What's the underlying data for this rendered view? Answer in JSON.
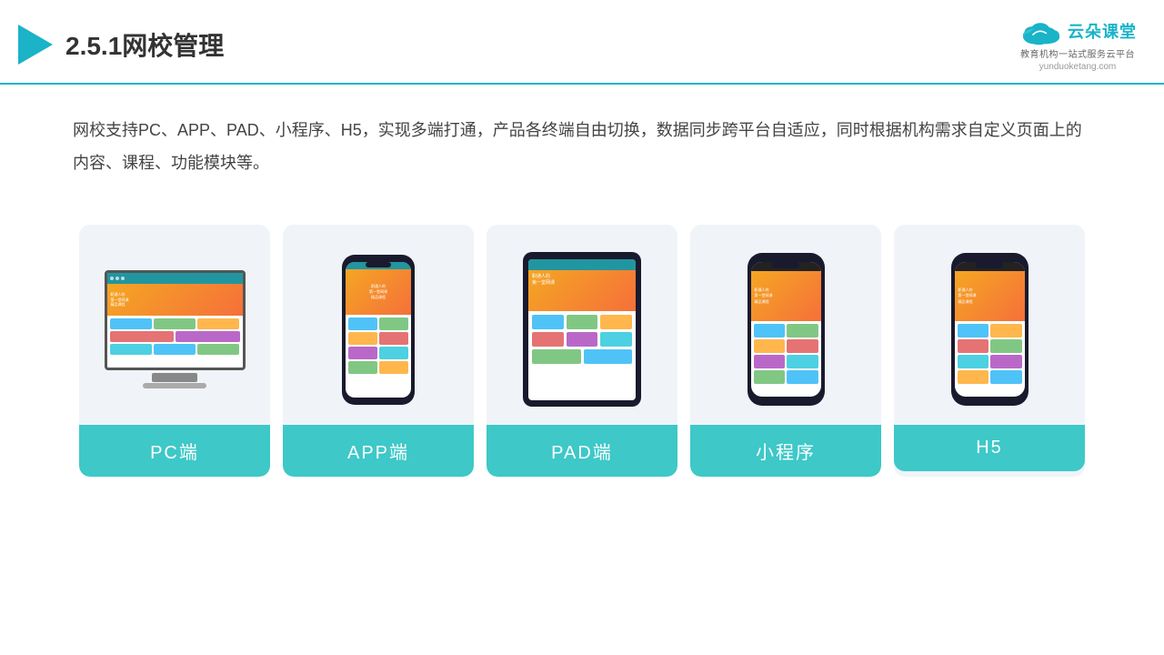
{
  "header": {
    "title": "2.5.1网校管理",
    "logo_text": "云朵课堂",
    "logo_sub": "教育机构一站式服务云平台",
    "logo_url": "yunduoketang.com"
  },
  "description": {
    "text": "网校支持PC、APP、PAD、小程序、H5，实现多端打通，产品各终端自由切换，数据同步跨平台自适应，同时根据机构需求自定义页面上的内容、课程、功能模块等。"
  },
  "cards": [
    {
      "id": "pc",
      "label": "PC端",
      "type": "monitor"
    },
    {
      "id": "app",
      "label": "APP端",
      "type": "phone"
    },
    {
      "id": "pad",
      "label": "PAD端",
      "type": "tablet"
    },
    {
      "id": "miniprogram",
      "label": "小程序",
      "type": "mini-phone"
    },
    {
      "id": "h5",
      "label": "H5",
      "type": "mini-phone"
    }
  ],
  "colors": {
    "accent": "#1ab3c8",
    "card_label_bg": "#3ec8c8",
    "card_bg": "#f0f4f8"
  }
}
